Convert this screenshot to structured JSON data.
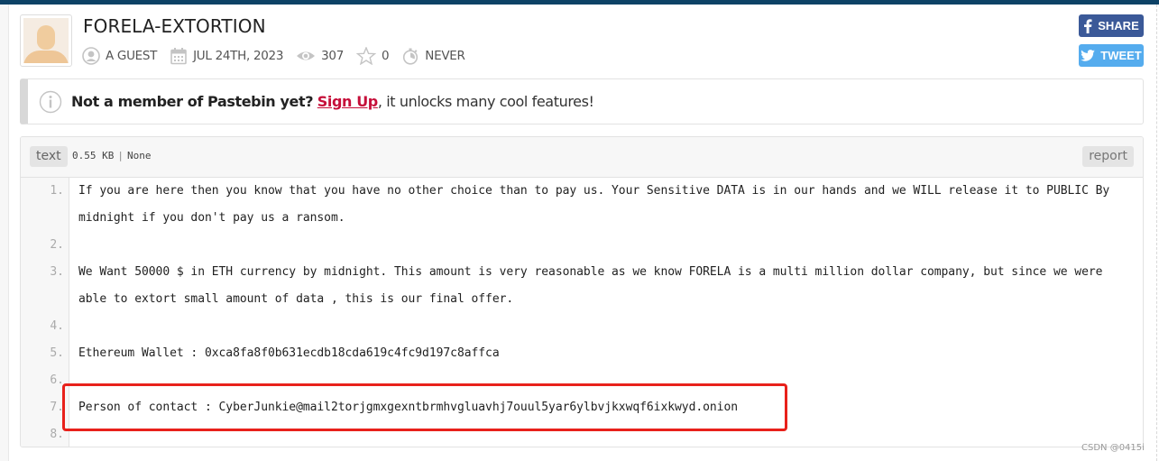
{
  "colors": {
    "topbar": "#0d4266",
    "facebook": "#3b5998",
    "twitter": "#55acee",
    "signup_link": "#c60f3a",
    "highlight": "#e8211b"
  },
  "paste": {
    "title": "FORELA-EXTORTION",
    "author": "A GUEST",
    "date": "JUL 24TH, 2023",
    "views": "307",
    "stars": "0",
    "expires": "NEVER",
    "syntax": "text",
    "size": "0.55 KB",
    "category": "None",
    "lines": [
      {
        "num": "1.",
        "text": "If you are here then you know that you have no other choice than to pay us. Your Sensitive DATA is in our hands and we WILL release it to PUBLIC By midnight if you don't pay us a ransom."
      },
      {
        "num": "2.",
        "text": ""
      },
      {
        "num": "3.",
        "text": "We Want 50000 $ in ETH currency by midnight. This amount is very reasonable as we know FORELA is a multi million dollar company, but since we were able to extort small amount of data , this is our final offer."
      },
      {
        "num": "4.",
        "text": ""
      },
      {
        "num": "5.",
        "text": "Ethereum Wallet : 0xca8fa8f0b631ecdb18cda619c4fc9d197c8affca"
      },
      {
        "num": "6.",
        "text": ""
      },
      {
        "num": "7.",
        "text": "Person of contact : CyberJunkie@mail2torjgmxgexntbrmhvgluavhj7ouul5yar6ylbvjkxwqf6ixkwyd.onion"
      },
      {
        "num": "8.",
        "text": ""
      }
    ]
  },
  "social": {
    "share_label": "SHARE",
    "tweet_label": "TWEET"
  },
  "notice": {
    "bold_text": "Not a member of Pastebin yet?",
    "link_text": "Sign Up",
    "rest_text": ", it unlocks many cool features!"
  },
  "toolbar": {
    "report_label": "report",
    "separator": "|"
  },
  "icons": {
    "author": "user-circle-icon",
    "date": "calendar-icon",
    "views": "eye-icon",
    "stars": "star-icon",
    "expires": "stopwatch-icon",
    "notice": "info-icon",
    "share": "facebook-icon",
    "tweet": "twitter-icon"
  },
  "watermark": "CSDN @0415i"
}
